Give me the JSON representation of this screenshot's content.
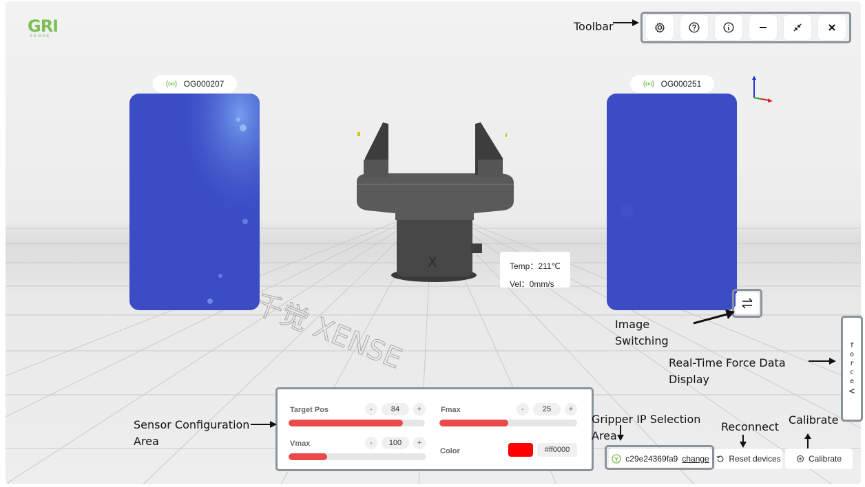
{
  "brand": {
    "logo_main": "GRI",
    "logo_sub": "XENSE"
  },
  "toolbar": {
    "buttons": [
      {
        "icon": "gear-icon"
      },
      {
        "icon": "help-icon"
      },
      {
        "icon": "info-icon"
      },
      {
        "icon": "minimize-icon"
      },
      {
        "icon": "collapse-icon"
      },
      {
        "icon": "close-icon"
      }
    ]
  },
  "sensors": {
    "left": {
      "id": "OG000207"
    },
    "right": {
      "id": "OG000251"
    }
  },
  "gripper_status": {
    "temp": "Temp：211℃",
    "vel": "Vel：0mm/s"
  },
  "floor_watermark": "千觉 XENSE",
  "annotations": {
    "toolbar": "Toolbar",
    "image_switching": "Image Switching",
    "force_display": "Real-Time Force Data Display",
    "sensor_config": "Sensor Configuration Area",
    "gripper_ip": "Gripper IP Selection Area",
    "reconnect": "Reconnect",
    "calibrate": "Calibrate"
  },
  "force_tab": {
    "label_chars": [
      "f",
      "o",
      "r",
      "c",
      "e"
    ],
    "chevron": "<"
  },
  "config": {
    "target_pos": {
      "label": "Target Pos",
      "value": "84",
      "fraction": 0.84,
      "minus": "-",
      "plus": "+"
    },
    "fmax": {
      "label": "Fmax",
      "value": "25",
      "fraction": 0.5,
      "minus": "-",
      "plus": "+"
    },
    "vmax": {
      "label": "Vmax",
      "value": "100",
      "fraction": 0.28,
      "minus": "-",
      "plus": "+"
    },
    "color": {
      "label": "Color",
      "value": "#ff0000",
      "swatch": "#ff0000"
    }
  },
  "gripper_ip": {
    "ip": "c29e24369fa9",
    "change_label": "change"
  },
  "reset_button": {
    "label": "Reset devices"
  },
  "calibrate_button": {
    "label": "Calibrate"
  },
  "colors": {
    "accent": "#7cbf58",
    "sensor_blue": "#3b4cc4",
    "slider_red": "#ec4a4a",
    "highlight": "#8c929b"
  }
}
